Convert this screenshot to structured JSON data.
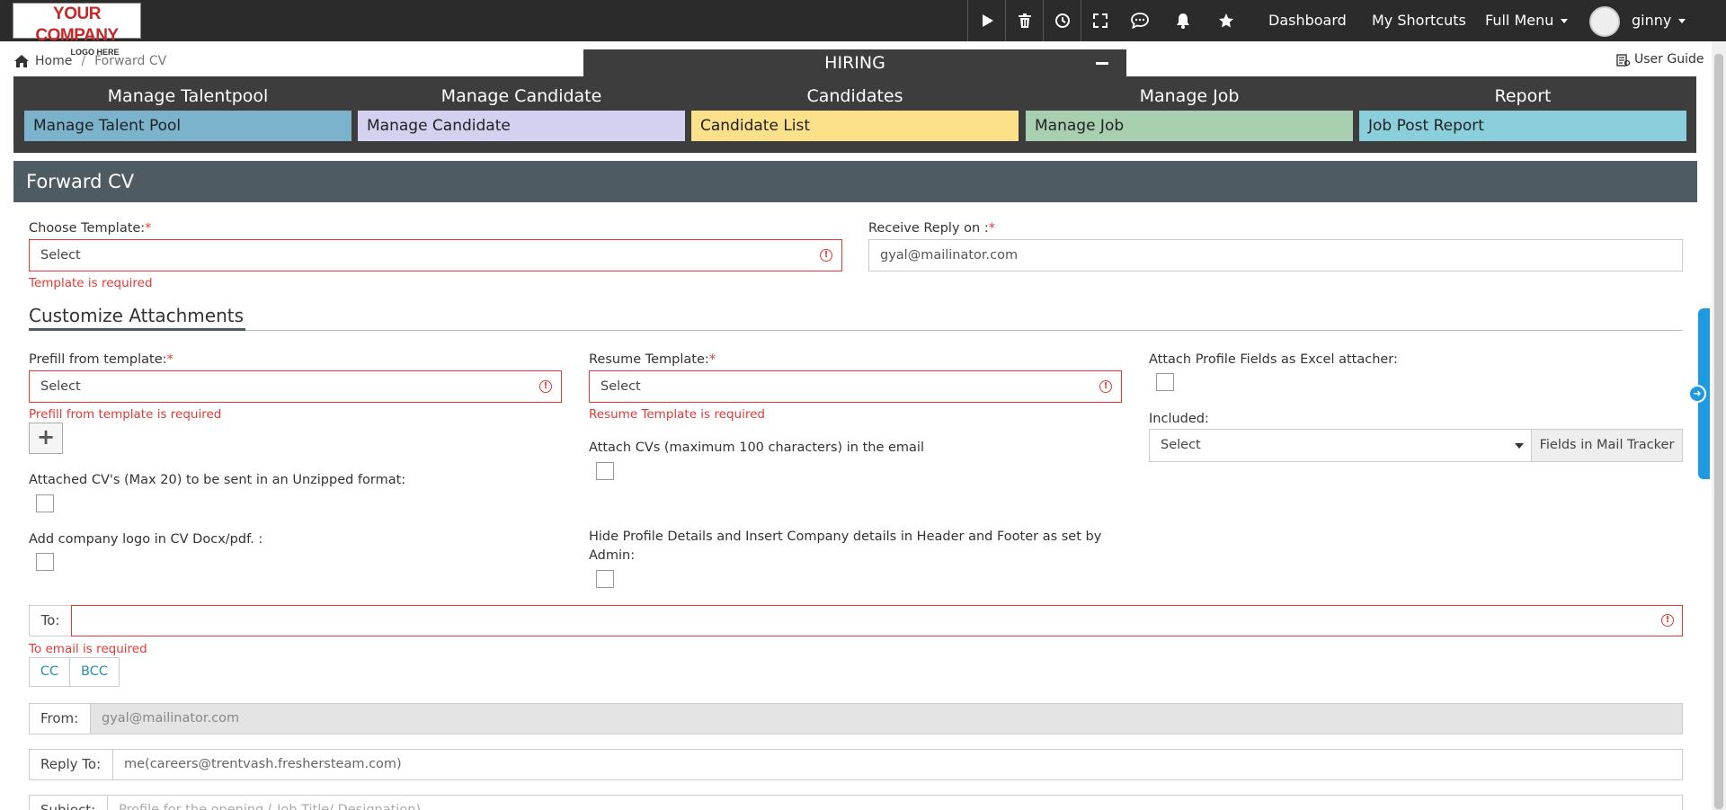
{
  "logo": {
    "line1": "YOUR COMPANY",
    "line2": "LOGO HERE"
  },
  "topnav": {
    "icons": [
      "play-icon",
      "trash-icon",
      "clock-icon",
      "fullscreen-icon",
      "chat-icon",
      "bell-icon",
      "star-icon"
    ],
    "dashboard": "Dashboard",
    "shortcuts": "My Shortcuts",
    "full_menu": "Full Menu",
    "user": "ginny"
  },
  "breadcrumb": {
    "home": "Home",
    "current": "Forward CV"
  },
  "user_guide": "User Guide",
  "module": {
    "title": "HIRING",
    "columns": [
      {
        "title": "Manage Talentpool",
        "item": "Manage Talent Pool",
        "color": "#7cb3cc"
      },
      {
        "title": "Manage Candidate",
        "item": "Manage Candidate",
        "color": "#d4d0f0"
      },
      {
        "title": "Candidates",
        "item": "Candidate List",
        "color": "#fde08a"
      },
      {
        "title": "Manage Job",
        "item": "Manage Job",
        "color": "#a8d0b0"
      },
      {
        "title": "Report",
        "item": "Job Post Report",
        "color": "#8ccfdc"
      }
    ]
  },
  "page_title": "Forward CV",
  "form": {
    "choose_template": {
      "label": "Choose Template:",
      "required": "*",
      "value": "Select",
      "error": "Template is required"
    },
    "receive_reply": {
      "label": "Receive Reply on :",
      "required": "*",
      "value": "gyal@mailinator.com"
    },
    "section_title": "Customize Attachments",
    "prefill": {
      "label": "Prefill from template:",
      "required": "*",
      "value": "Select",
      "error": "Prefill from template is required"
    },
    "resume_template": {
      "label": "Resume Template:",
      "required": "*",
      "value": "Select",
      "error": "Resume Template is required"
    },
    "attach_excel": {
      "label": "Attach Profile Fields as Excel attacher:"
    },
    "included": {
      "label": "Included:",
      "value": "Select",
      "button": "Fields in Mail Tracker"
    },
    "plus_label": "+",
    "attach_cvs": {
      "label": "Attach CVs (maximum 100 characters) in the email"
    },
    "unzipped": {
      "label": "Attached CV's (Max 20) to be sent in an Unzipped format:"
    },
    "company_logo": {
      "label": "Add company logo in CV Docx/pdf. :"
    },
    "hide_profile": {
      "label_line1": "Hide Profile Details and Insert Company details in Header and Footer as set by",
      "label_line2": "Admin:"
    },
    "to": {
      "label": "To:",
      "error": "To email is required"
    },
    "cc": "CC",
    "bcc": "BCC",
    "from": {
      "label": "From:",
      "value": "gyal@mailinator.com"
    },
    "reply_to": {
      "label": "Reply To:",
      "value": "me(careers@trentvash.freshersteam.com)"
    },
    "subject": {
      "label": "Subject:",
      "value": "Profile for the opening ( Job Title/ Designation)"
    }
  }
}
